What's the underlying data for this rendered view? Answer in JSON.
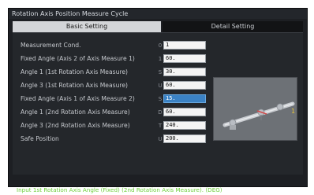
{
  "window": {
    "title": "Rotation Axis Position Measure Cycle"
  },
  "tabs": [
    {
      "label": "Basic Setting",
      "active": true
    },
    {
      "label": "Detail Setting",
      "active": false
    }
  ],
  "fields": [
    {
      "label": "Measurement Cond.",
      "prefix": "0",
      "value": "1"
    },
    {
      "label": "Fixed Angle (Axis 2 of Axis Measure 1)",
      "prefix": "1",
      "value": "60."
    },
    {
      "label": "Angle 1 (1st Rotation Axis Measure)",
      "prefix": "S",
      "value": "30."
    },
    {
      "label": "Angle 3 (1st Rotation Axis Measure)",
      "prefix": "U",
      "value": "60."
    },
    {
      "label": "Fixed Angle (Axis 1 of Axis Measure 2)",
      "prefix": "S",
      "value": "15.",
      "selected": true
    },
    {
      "label": "Angle 1 (2nd Rotation Axis Measure)",
      "prefix": "D",
      "value": "60."
    },
    {
      "label": "Angle 3 (2nd Rotation Axis Measure)",
      "prefix": "T",
      "value": "240."
    },
    {
      "label": "Safe Position",
      "prefix": "U",
      "value": "200."
    }
  ],
  "diagram": {
    "label": "1"
  },
  "status": {
    "message": "Input 1st Rotation Axis Angle (Fixed) (2nd Rotation Axis Measure). (DEG)",
    "color": "#6fcf3d"
  }
}
